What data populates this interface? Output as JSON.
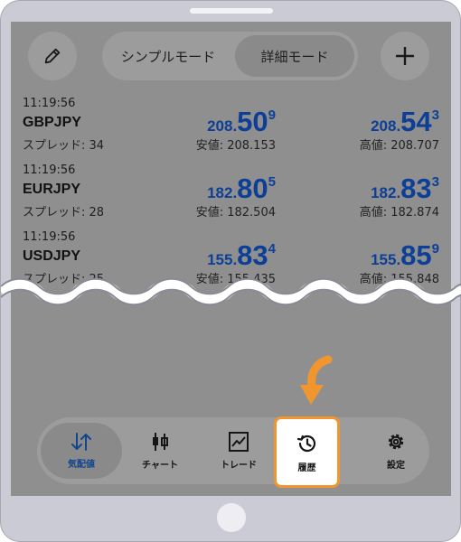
{
  "modes": {
    "simple_label": "シンプルモード",
    "detail_label": "詳細モード"
  },
  "quotes": [
    {
      "time": "11:19:56",
      "symbol": "GBPJPY",
      "spread": "スプレッド: 34",
      "bid": {
        "main": "208.",
        "big": "50",
        "sup": "9"
      },
      "ask": {
        "main": "208.",
        "big": "54",
        "sup": "3"
      },
      "low": "安値: 208.153",
      "high": "高値: 208.707"
    },
    {
      "time": "11:19:56",
      "symbol": "EURJPY",
      "spread": "スプレッド: 28",
      "bid": {
        "main": "182.",
        "big": "80",
        "sup": "5"
      },
      "ask": {
        "main": "182.",
        "big": "83",
        "sup": "3"
      },
      "low": "安値: 182.504",
      "high": "高値: 182.874"
    },
    {
      "time": "11:19:56",
      "symbol": "USDJPY",
      "spread": "スプレッド: 25",
      "bid": {
        "main": "155.",
        "big": "83",
        "sup": "4"
      },
      "ask": {
        "main": "155.",
        "big": "85",
        "sup": "9"
      },
      "low": "安値: 155.435",
      "high": "高値: 155.848"
    }
  ],
  "nav": [
    {
      "label": "気配値",
      "icon": "quotes-arrows-icon",
      "active": true
    },
    {
      "label": "チャート",
      "icon": "candlestick-icon"
    },
    {
      "label": "トレード",
      "icon": "trade-chart-icon"
    },
    {
      "label": "履歴",
      "icon": "history-clock-icon",
      "highlighted": true
    },
    {
      "label": "設定",
      "icon": "gear-icon"
    }
  ],
  "colors": {
    "price_blue": "#0d3f96",
    "highlight_orange": "#f1962f",
    "active_nav": "#11468f",
    "screen_overlay": "#8f8f8f"
  }
}
